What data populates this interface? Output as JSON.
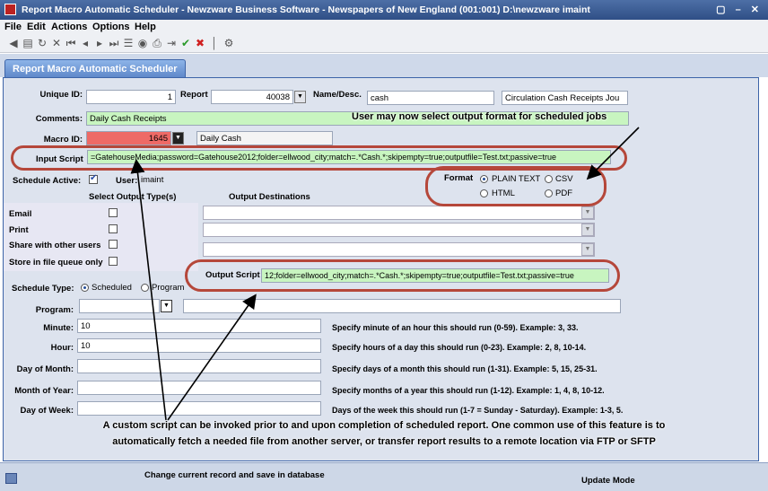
{
  "window": {
    "title": "Report Macro Automatic Scheduler - Newzware Business Software - Newspapers of New England  (001:001)  D:\\newzware  imaint",
    "controls": "▢ – ✕"
  },
  "menu": [
    "File",
    "Edit",
    "Actions",
    "Options",
    "Help"
  ],
  "toolbar": {
    "icons": [
      {
        "name": "back-icon",
        "glyph": "◀"
      },
      {
        "name": "document-icon",
        "glyph": "▤"
      },
      {
        "name": "refresh-icon",
        "glyph": "↻"
      },
      {
        "name": "delete-icon",
        "glyph": "✕"
      },
      {
        "name": "first-record-icon",
        "glyph": "⏮"
      },
      {
        "name": "previous-record-icon",
        "glyph": "◂"
      },
      {
        "name": "next-record-icon",
        "glyph": "▸"
      },
      {
        "name": "last-record-icon",
        "glyph": "⏭"
      },
      {
        "name": "list-icon",
        "glyph": "☰"
      },
      {
        "name": "stack-icon",
        "glyph": "◉"
      },
      {
        "name": "print-icon",
        "glyph": "⎙"
      },
      {
        "name": "export-icon",
        "glyph": "⇥"
      },
      {
        "name": "save-check-icon",
        "glyph": "✔"
      },
      {
        "name": "cancel-icon",
        "glyph": "✖"
      },
      {
        "name": "divider-icon",
        "glyph": "│"
      },
      {
        "name": "help-icon",
        "glyph": "⚙"
      }
    ]
  },
  "tab": {
    "label": "Report Macro Automatic Scheduler"
  },
  "form": {
    "unique_id_label": "Unique ID:",
    "unique_id_value": "1",
    "report_label": "Report",
    "report_value": "40038",
    "name_desc_label": "Name/Desc.",
    "name_desc_value": "cash",
    "name_desc_extra": "Circulation Cash Receipts Jou",
    "comments_label": "Comments:",
    "comments_value": "Daily Cash Receipts",
    "macro_id_label": "Macro ID:",
    "macro_id_value": "1645",
    "macro_desc": "Daily Cash",
    "input_script_label": "Input Script",
    "input_script_value": "=GatehouseMedia;password=Gatehouse2012;folder=ellwood_city;match=.*Cash.*;skipempty=true;outputfile=Test.txt;passive=true",
    "schedule_active_label": "Schedule Active:",
    "user_label": "User:",
    "user_value": "imaint",
    "format_label": "Format",
    "format_options": [
      "PLAIN TEXT",
      "CSV",
      "HTML",
      "PDF"
    ],
    "select_output_types_label": "Select Output Type(s)",
    "output_destinations_label": "Output Destinations",
    "output_types": [
      "Email",
      "Print",
      "Share with other users",
      "Store in file queue only"
    ],
    "output_script_label": "Output Script",
    "output_script_value": "12;folder=ellwood_city;match=.*Cash.*;skipempty=true;outputfile=Test.txt;passive=true",
    "schedule_type_label": "Schedule Type:",
    "schedule_type_options": [
      "Scheduled",
      "Program"
    ],
    "program_label": "Program:",
    "minute_label": "Minute:",
    "minute_value": "10",
    "minute_hint": "Specify minute of an hour this should run (0-59). Example:  3, 33.",
    "hour_label": "Hour:",
    "hour_value": "10",
    "hour_hint": "Specify hours of a day this should run (0-23). Example: 2, 8, 10-14.",
    "dom_label": "Day of Month:",
    "dom_hint": "Specify days of a month this should run (1-31). Example: 5, 15, 25-31.",
    "moy_label": "Month of Year:",
    "moy_hint": "Specify months of a year this should run (1-12). Example: 1, 4, 8, 10-12.",
    "dow_label": "Day of Week:",
    "dow_hint": "Days of the week this should run (1-7 = Sunday - Saturday). Example: 1-3, 5."
  },
  "annotations": {
    "top": "User may now select output format for scheduled jobs",
    "bottom_line1": "A custom script can be invoked prior to and upon completion of scheduled report.   One common use of this feature is to",
    "bottom_line2": "automatically fetch a needed file from another server, or transfer report results to a remote location via FTP or SFTP"
  },
  "status": {
    "message": "Change current record and save in database",
    "mode": "Update Mode"
  }
}
